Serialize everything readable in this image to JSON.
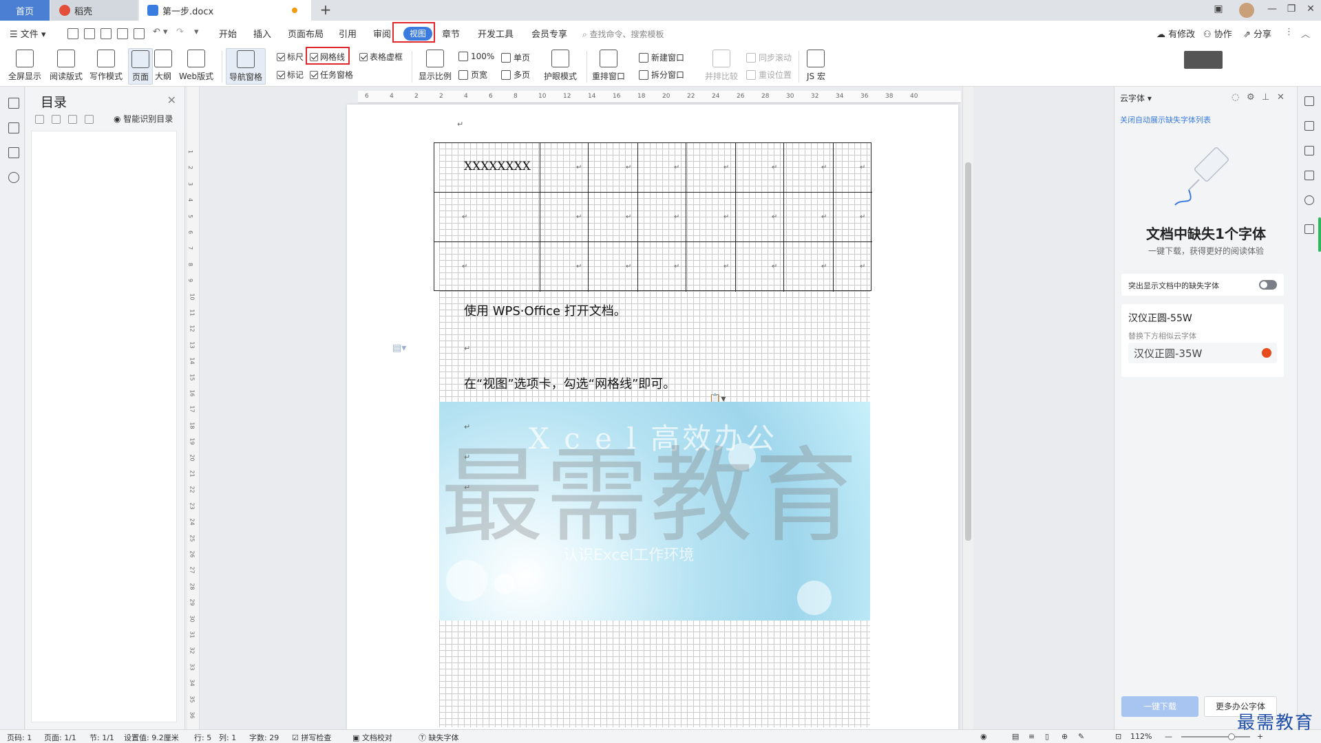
{
  "tabs": [
    {
      "label": "首页"
    },
    {
      "label": "稻壳"
    },
    {
      "label": "第一步.docx"
    }
  ],
  "menu": {
    "file": "文件",
    "items": [
      "开始",
      "插入",
      "页面布局",
      "引用",
      "审阅",
      "视图",
      "章节",
      "开发工具",
      "会员专享"
    ],
    "search_placeholder": "查找命令、搜索模板",
    "right": [
      "有修改",
      "协作",
      "分享"
    ]
  },
  "ribbon": {
    "fullscreen": "全屏显示",
    "read": "阅读版式",
    "write": "写作模式",
    "page": "页面",
    "outline": "大纲",
    "web": "Web版式",
    "nav": "导航窗格",
    "ruler": "标尺",
    "gridlines": "网格线",
    "table_border": "表格虚框",
    "mark": "标记",
    "task_pane": "任务窗格",
    "zoom": "显示比例",
    "zoom100": "100%",
    "page_width": "页宽",
    "single": "单页",
    "multi": "多页",
    "eye_mode": "护眼模式",
    "arrange": "重排窗口",
    "new_window": "新建窗口",
    "split": "拆分窗口",
    "compare": "并排比较",
    "sync_scroll": "同步滚动",
    "reset_pos": "重设位置",
    "macro": "JS 宏"
  },
  "toc": {
    "title": "目录",
    "smart": "智能识别目录"
  },
  "document": {
    "table_cell": "XXXXXXXX",
    "para1": "使用 WPS·Office 打开文档。",
    "para2": "在“视图”选项卡，勾选“网格线”即可。",
    "image_title": "X c e l   高效办公",
    "image_sub": "认识Excel工作环境",
    "watermark": "最需教育"
  },
  "ruler_h": [
    "6",
    "4",
    "2",
    "2",
    "4",
    "6",
    "8",
    "10",
    "12",
    "14",
    "16",
    "18",
    "20",
    "22",
    "24",
    "26",
    "28",
    "30",
    "32",
    "34",
    "36",
    "38",
    "40"
  ],
  "right_panel": {
    "title": "云字体",
    "close_auto": "关闭自动展示缺失字体列表",
    "heading": "文档中缺失1个字体",
    "sub": "一键下载，获得更好的阅读体验",
    "toggle_label": "突出显示文档中的缺失字体",
    "font_name": "汉仪正圆-55W",
    "font_hint": "替换下方相似云字体",
    "font_alt": "汉仪正圆-35W",
    "download": "一键下载",
    "more": "更多办公字体"
  },
  "status": {
    "page": "页码: 1",
    "pages": "页面: 1/1",
    "section": "节: 1/1",
    "setting": "设置值: 9.2厘米",
    "row": "行: 5",
    "col": "列: 1",
    "words": "字数: 29",
    "spell": "拼写检查",
    "proof": "文档校对",
    "missing_font": "缺失字体",
    "zoom": "112%"
  },
  "corner_watermark": "最需教育"
}
